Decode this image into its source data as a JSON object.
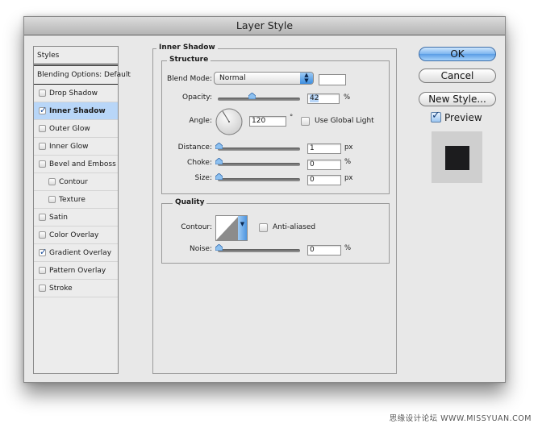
{
  "window": {
    "title": "Layer Style"
  },
  "styles_list": {
    "header": "Styles",
    "blending_options": "Blending Options: Default",
    "items": [
      {
        "label": "Drop Shadow",
        "checked": false,
        "selected": false,
        "indent": false
      },
      {
        "label": "Inner Shadow",
        "checked": true,
        "selected": true,
        "indent": false
      },
      {
        "label": "Outer Glow",
        "checked": false,
        "selected": false,
        "indent": false
      },
      {
        "label": "Inner Glow",
        "checked": false,
        "selected": false,
        "indent": false
      },
      {
        "label": "Bevel and Emboss",
        "checked": false,
        "selected": false,
        "indent": false
      },
      {
        "label": "Contour",
        "checked": false,
        "selected": false,
        "indent": true
      },
      {
        "label": "Texture",
        "checked": false,
        "selected": false,
        "indent": true
      },
      {
        "label": "Satin",
        "checked": false,
        "selected": false,
        "indent": false
      },
      {
        "label": "Color Overlay",
        "checked": false,
        "selected": false,
        "indent": false
      },
      {
        "label": "Gradient Overlay",
        "checked": true,
        "selected": false,
        "indent": false
      },
      {
        "label": "Pattern Overlay",
        "checked": false,
        "selected": false,
        "indent": false
      },
      {
        "label": "Stroke",
        "checked": false,
        "selected": false,
        "indent": false
      }
    ]
  },
  "panel": {
    "title": "Inner Shadow",
    "structure": {
      "title": "Structure",
      "blend_mode_label": "Blend Mode:",
      "blend_mode_value": "Normal",
      "shadow_color": "#ffffff",
      "opacity_label": "Opacity:",
      "opacity_value": "42",
      "opacity_unit": "%",
      "opacity_fraction": 0.42,
      "angle_label": "Angle:",
      "angle_value": "120",
      "angle_unit": "°",
      "use_global_light_label": "Use Global Light",
      "use_global_light_checked": false,
      "distance_label": "Distance:",
      "distance_value": "1",
      "distance_unit": "px",
      "choke_label": "Choke:",
      "choke_value": "0",
      "choke_unit": "%",
      "size_label": "Size:",
      "size_value": "0",
      "size_unit": "px"
    },
    "quality": {
      "title": "Quality",
      "contour_label": "Contour:",
      "anti_aliased_label": "Anti-aliased",
      "anti_aliased_checked": false,
      "noise_label": "Noise:",
      "noise_value": "0",
      "noise_unit": "%"
    }
  },
  "buttons": {
    "ok": "OK",
    "cancel": "Cancel",
    "new_style": "New Style...",
    "preview_label": "Preview",
    "preview_checked": true
  },
  "colors": {
    "accent": "#5a9de5",
    "selection": "#b8d6f8",
    "preview_swatch": "#1c1c1e"
  },
  "watermark": "思缘设计论坛 WWW.MISSYUAN.COM"
}
